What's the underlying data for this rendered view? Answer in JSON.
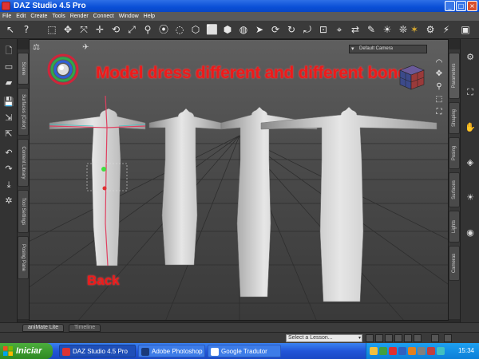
{
  "window": {
    "title": "DAZ Studio 4.5 Pro",
    "controls": {
      "minimize": "_",
      "maximize": "□",
      "close": "×"
    }
  },
  "menu": [
    "File",
    "Edit",
    "Create",
    "Tools",
    "Render",
    "Connect",
    "Window",
    "Help"
  ],
  "left_tabs": [
    "Scene",
    "Surfaces (Color)",
    "Content Library",
    "Tool Settings",
    "Posing Pane"
  ],
  "right_tabs": [
    "Parameters",
    "Shaping",
    "Posing",
    "Surfaces",
    "Lights",
    "Cameras"
  ],
  "viewport": {
    "camera": "Default Camera",
    "overlay_text": "Model dress different and different bones.",
    "back_label": "Back"
  },
  "bottom_tabs": [
    "aniMate Lite",
    "Timeline"
  ],
  "status": {
    "lesson_placeholder": "Select a Lesson..."
  },
  "taskbar": {
    "start": "Iniciar",
    "tasks": [
      "DAZ Studio 4.5 Pro",
      "Adobe Photoshop",
      "Google Tradutor"
    ],
    "clock": "15:34"
  },
  "icons": {
    "toolbar": [
      "help-icon",
      "select-icon",
      "move-icon",
      "rotate-icon",
      "scale-icon",
      "joint-editor-icon",
      "node-weight-icon",
      "pointer-icon",
      "render-icon",
      "camera-icon"
    ],
    "left": [
      "new-file-icon",
      "open-file-icon",
      "save-icon",
      "import-icon",
      "undo-icon",
      "render-settings-icon"
    ],
    "viewport": [
      "view-sphere-icon",
      "pan-icon",
      "zoom-icon",
      "frame-icon",
      "fit-icon"
    ]
  },
  "colors": {
    "overlay_text": "#ee1a1a",
    "accent": "#e0b030",
    "taskbar": "#2255d8"
  }
}
